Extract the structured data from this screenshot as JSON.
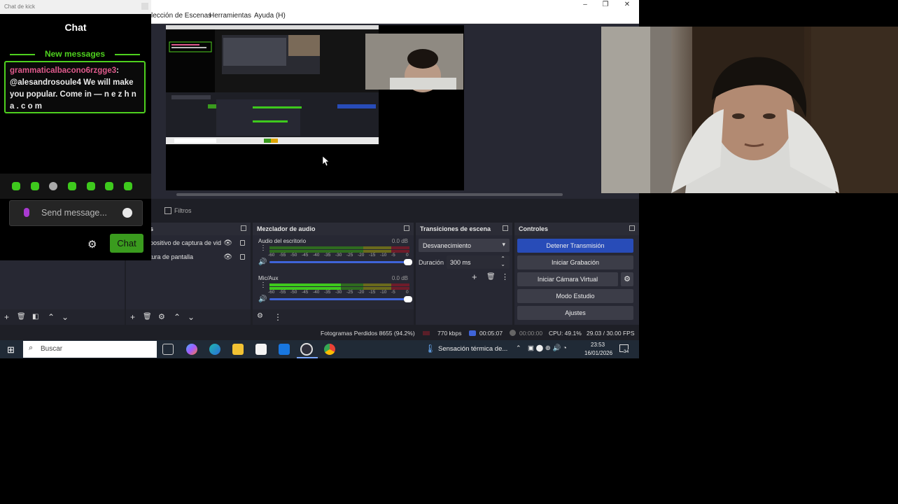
{
  "obs": {
    "menu": [
      "lección de Escenas",
      "Herramientas",
      "Ayuda (H)"
    ],
    "filters_label": "Filtros",
    "sources_title_partial": "s",
    "sources": [
      {
        "name": "positivo de captura de vid"
      },
      {
        "name": "tura de pantalla"
      }
    ],
    "mixer": {
      "title": "Mezclador de audio",
      "tracks": [
        {
          "name": "Audio del escritorio",
          "db": "0.0 dB"
        },
        {
          "name": "Mic/Aux",
          "db": "0.0 dB"
        }
      ],
      "ticks": [
        "-60",
        "-55",
        "-50",
        "-45",
        "-40",
        "-35",
        "-30",
        "-25",
        "-20",
        "-15",
        "-10",
        "-5",
        "0"
      ]
    },
    "transitions": {
      "title": "Transiciones de escena",
      "selected": "Desvanecimiento",
      "duration_label": "Duración",
      "duration_value": "300 ms"
    },
    "controls": {
      "title": "Controles",
      "stop_stream": "Detener Transmisión",
      "start_recording": "Iniciar Grabación",
      "start_virtual_cam": "Iniciar Cámara Virtual",
      "studio_mode": "Modo Estudio",
      "settings": "Ajustes"
    },
    "status": {
      "dropped_frames": "Fotogramas Perdidos 8655 (94.2%)",
      "bitrate": "770 kbps",
      "stream_time": "00:05:07",
      "rec_time": "00:00:00",
      "cpu": "CPU: 49.1%",
      "fps": "29.03 / 30.00 FPS"
    }
  },
  "taskbar": {
    "search_placeholder": "Buscar",
    "weather": "Sensación térmica de...",
    "time": "23:53",
    "date": "16/01/2026",
    "notif_count": "34"
  },
  "chat": {
    "window_title": "Chat de kick",
    "title": "Chat",
    "new_messages": "New messages",
    "message_user": "grammaticalbacono6rzgge3",
    "message_text": ": @alesandrosoule4 We will make you popular. Come in — n e z h n a . c o m",
    "input_placeholder": "Send message...",
    "send_label": "Chat"
  },
  "colors": {
    "kick_green": "#4ed01e",
    "obs_panel": "#272833",
    "stream_button": "#284cb8",
    "username": "#e05a8c"
  }
}
